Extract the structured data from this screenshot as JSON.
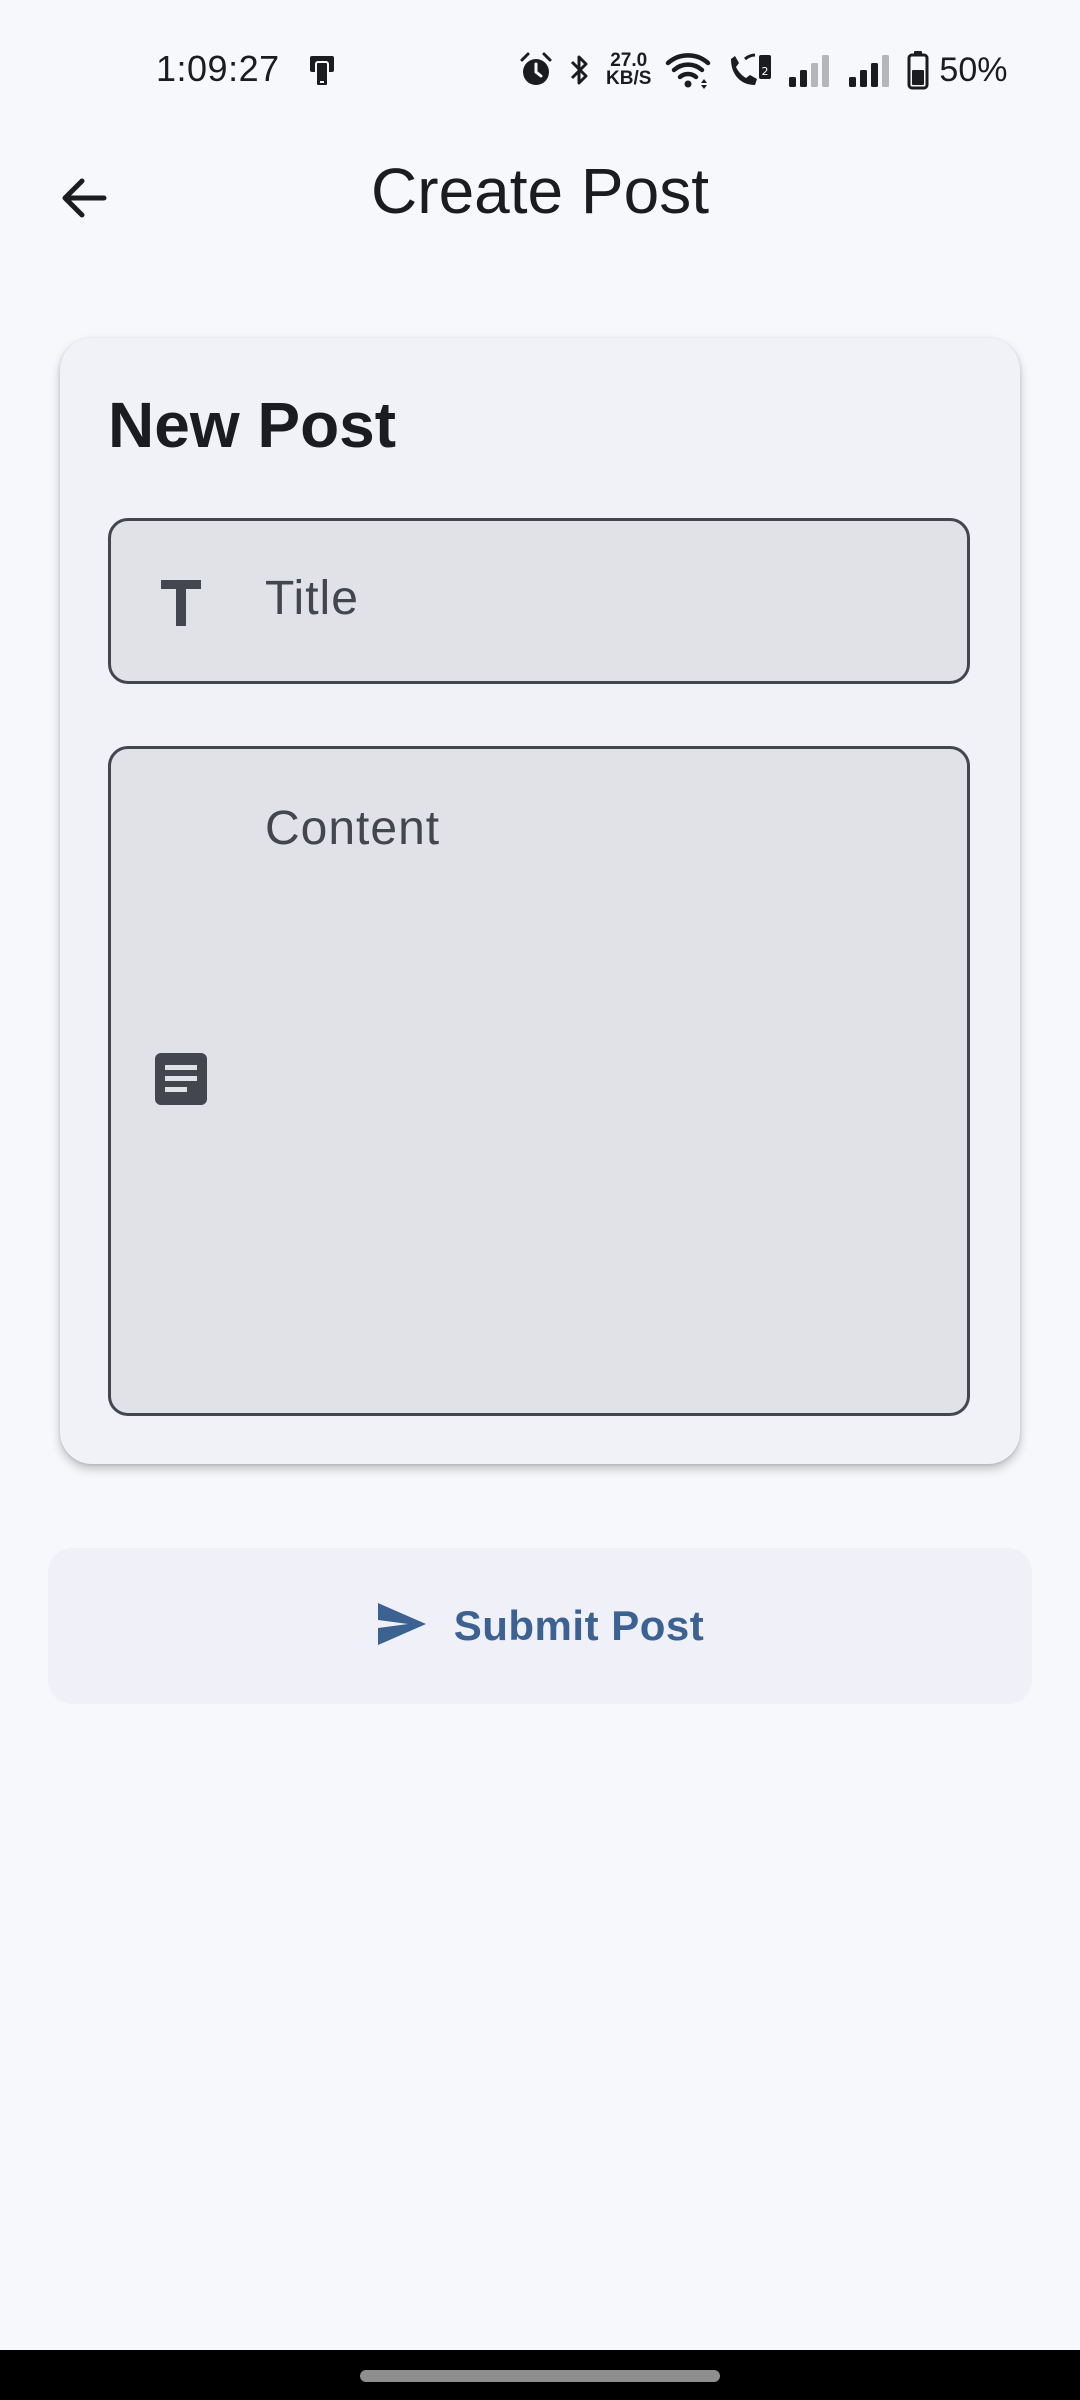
{
  "status_bar": {
    "time": "1:09:27",
    "net_speed_value": "27.0",
    "net_speed_unit": "KB/S",
    "battery_percent": "50%",
    "icons": [
      "screen-mirror-icon",
      "alarm-icon",
      "bluetooth-icon",
      "wifi-icon",
      "wifi-calling-icon",
      "signal-1-icon",
      "signal-2-icon",
      "battery-icon"
    ]
  },
  "app_bar": {
    "title": "Create Post",
    "back_icon": "arrow-back-icon"
  },
  "card": {
    "heading": "New Post",
    "title_field": {
      "icon": "text-t-icon",
      "placeholder": "Title",
      "value": ""
    },
    "content_field": {
      "icon": "article-icon",
      "placeholder": "Content",
      "value": ""
    }
  },
  "submit": {
    "icon": "send-icon",
    "label": "Submit Post"
  },
  "colors": {
    "background": "#f7f8fc",
    "card": "#f1f2f8",
    "field_fill": "#e1e2e8",
    "field_border": "#44464f",
    "accent": "#3c6291",
    "text": "#1b1c20"
  }
}
